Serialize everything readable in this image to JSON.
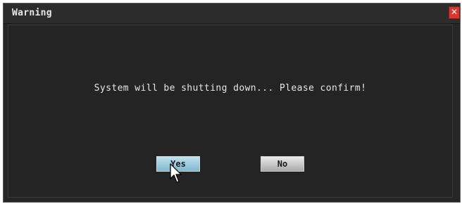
{
  "dialog": {
    "title": "Warning",
    "close_icon": "close-icon",
    "message": "System will be shutting down... Please confirm!",
    "buttons": {
      "yes": "Yes",
      "no": "No"
    }
  },
  "colors": {
    "background": "#262626",
    "title_text": "#e8e8e8",
    "close_red": "#d9372e",
    "yes_highlight": "#7fb6cf"
  }
}
